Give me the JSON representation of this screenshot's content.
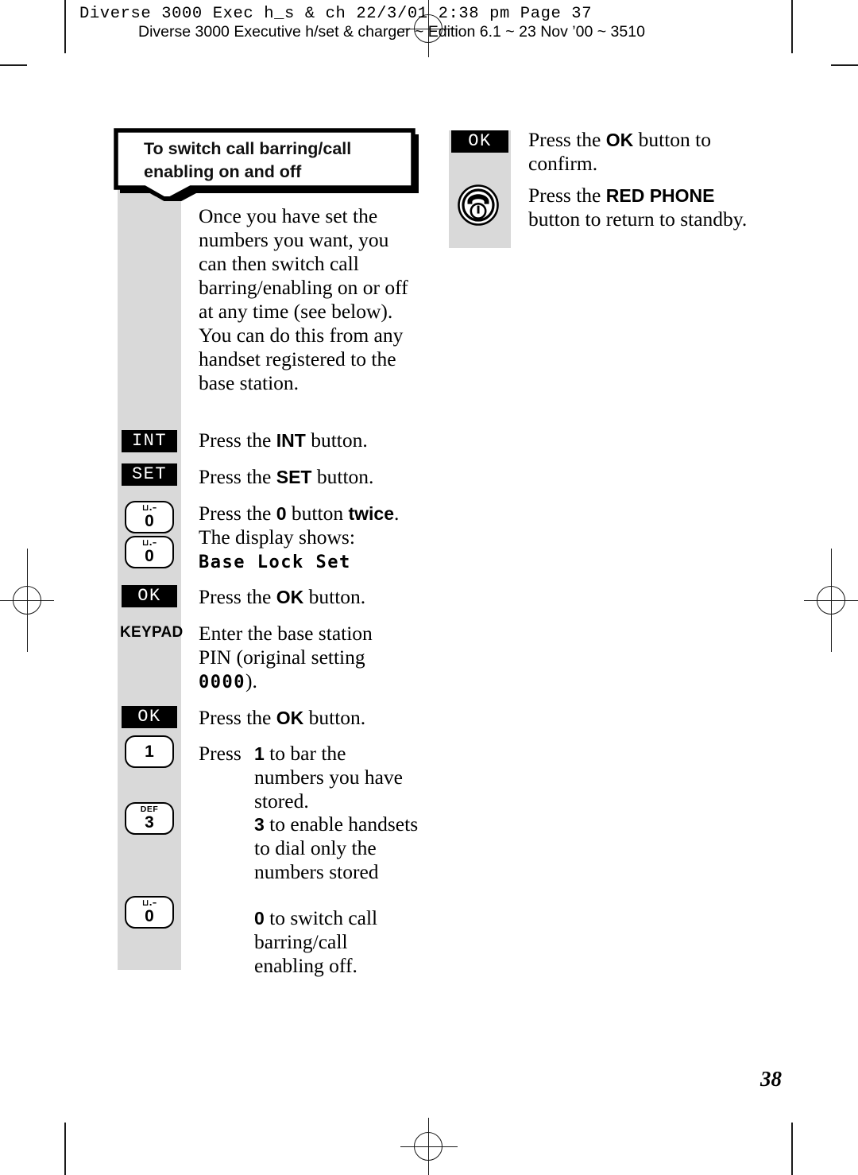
{
  "header": {
    "mono_line": "Diverse 3000 Exec h_s & ch  22/3/01  2:38 pm  Page 37",
    "sans_line": "Diverse 3000 Executive h/set & charger ~ Edition 6.1 ~ 23 Nov ’00 ~ 3510"
  },
  "callout": {
    "line1": "To switch call barring/call",
    "line2": "enabling on and off"
  },
  "intro": {
    "paragraph": "Once you have set the numbers you want, you can then switch call barring/enabling on or off at any time (see below). You can do this from any handset registered to the base station."
  },
  "left_column": {
    "steps": [
      {
        "icon": "int-key-icon",
        "icon_label": "INT",
        "text_before": "Press the ",
        "text_bold": "INT",
        "text_after": " button."
      },
      {
        "icon": "set-key-icon",
        "icon_label": "SET",
        "text_before": "Press the ",
        "text_bold": "SET",
        "text_after": " button."
      },
      {
        "icon": "zero-key-icon",
        "key_digit": "0",
        "key_sub": "⊔.–",
        "text_line1_a": "Press the ",
        "text_line1_b": "0",
        "text_line1_c": " button ",
        "text_line1_d": "twice",
        "text_line1_e": ".",
        "text_line2": "The display shows:",
        "lcd_text": "Base Lock Set"
      },
      {
        "icon": "ok-key-icon",
        "icon_label": "OK",
        "text_before": "Press the ",
        "text_bold": "OK",
        "text_after": " button."
      },
      {
        "icon": "keypad-icon",
        "icon_label": "KEYPAD",
        "text_line1": "Enter the base station",
        "text_line2": "PIN (original setting",
        "lcd_text": "0000",
        "text_line3_tail": ")."
      },
      {
        "icon": "ok-key-icon",
        "icon_label": "OK",
        "text_before": "Press the ",
        "text_bold": "OK",
        "text_after": " button."
      }
    ],
    "final_step": {
      "keys": [
        {
          "icon": "one-key-icon",
          "digit": "1",
          "sub": ""
        },
        {
          "icon": "three-key-icon",
          "digit": "3",
          "sub": "DEF"
        },
        {
          "icon": "zero-key-icon",
          "digit": "0",
          "sub": "⊔.–"
        }
      ],
      "lead": "Press",
      "options": [
        {
          "number": "1",
          "text": "to bar the numbers you have stored."
        },
        {
          "number": "3",
          "text": "to enable handsets to dial only the numbers stored"
        },
        {
          "number": "0",
          "text": "to switch call barring/call enabling off."
        }
      ]
    }
  },
  "right_column": {
    "steps": [
      {
        "icon": "ok-key-icon",
        "icon_label": "OK",
        "text_before": "Press the ",
        "text_bold": "OK",
        "text_after": " button to confirm."
      },
      {
        "icon": "red-phone-icon",
        "text_before": "Press the ",
        "text_bold": "RED PHONE",
        "text_after": " button to return to standby."
      }
    ]
  },
  "footer": {
    "page_number": "38"
  }
}
